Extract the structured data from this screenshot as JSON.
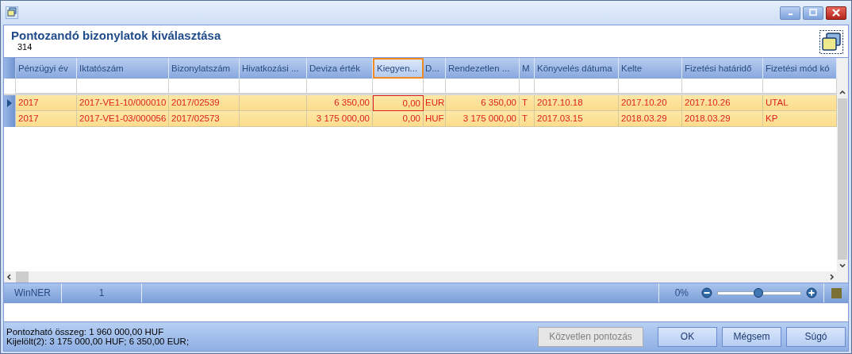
{
  "header": {
    "title": "Pontozandó bizonylatok kiválasztása",
    "subtitle": "314"
  },
  "table": {
    "columns": [
      {
        "label": "Pénzügyi év",
        "kind": "text",
        "focused": false
      },
      {
        "label": "Iktatószám",
        "kind": "text",
        "focused": false
      },
      {
        "label": "Bizonylatszám",
        "kind": "text",
        "focused": false
      },
      {
        "label": "Hivatkozási ...",
        "kind": "text",
        "focused": false
      },
      {
        "label": "Deviza érték",
        "kind": "amount",
        "focused": false
      },
      {
        "label": "Kiegyen...",
        "kind": "amount",
        "focused": true
      },
      {
        "label": "D...",
        "kind": "text",
        "focused": false
      },
      {
        "label": "Rendezetlen ...",
        "kind": "amount",
        "focused": false
      },
      {
        "label": "M",
        "kind": "text",
        "focused": false
      },
      {
        "label": "Könyvelés dátuma",
        "kind": "text",
        "focused": false
      },
      {
        "label": "Kelte",
        "kind": "text",
        "focused": false
      },
      {
        "label": "Fizetési határidő",
        "kind": "text",
        "focused": false
      },
      {
        "label": "Fizetési mód kó",
        "kind": "text",
        "focused": false
      }
    ],
    "rows": [
      {
        "current": true,
        "focused": true,
        "cells": [
          "2017",
          "2017-VE1-10/000010",
          "2017/02539",
          "",
          "6 350,00",
          "0,00",
          "EUR",
          "6 350,00",
          "T",
          "2017.10.18",
          "2017.10.20",
          "2017.10.26",
          "UTAL"
        ]
      },
      {
        "current": false,
        "focused": false,
        "cells": [
          "2017",
          "2017-VE1-03/000056",
          "2017/02573",
          "",
          "3 175 000,00",
          "0,00",
          "HUF",
          "3 175 000,00",
          "T",
          "2017.03.15",
          "2018.03.29",
          "2018.03.29",
          "KP"
        ]
      }
    ]
  },
  "status_bar": {
    "cells": [
      "WinNER",
      "1"
    ],
    "zoom_label": "0%",
    "zoom": {
      "level": 0.48
    },
    "color": "#7a7034"
  },
  "footer": {
    "lines": [
      "Pontozható összeg: 1 960 000,00 HUF",
      "Kijelölt(2): 3 175 000,00 HUF; 6 350,00 EUR;"
    ],
    "buttons": [
      {
        "label": "Közvetlen pontozás",
        "disabled": true
      },
      {
        "label": "OK",
        "disabled": false
      },
      {
        "label": "Mégsem",
        "disabled": false
      },
      {
        "label": "Súgó",
        "disabled": false
      }
    ]
  }
}
